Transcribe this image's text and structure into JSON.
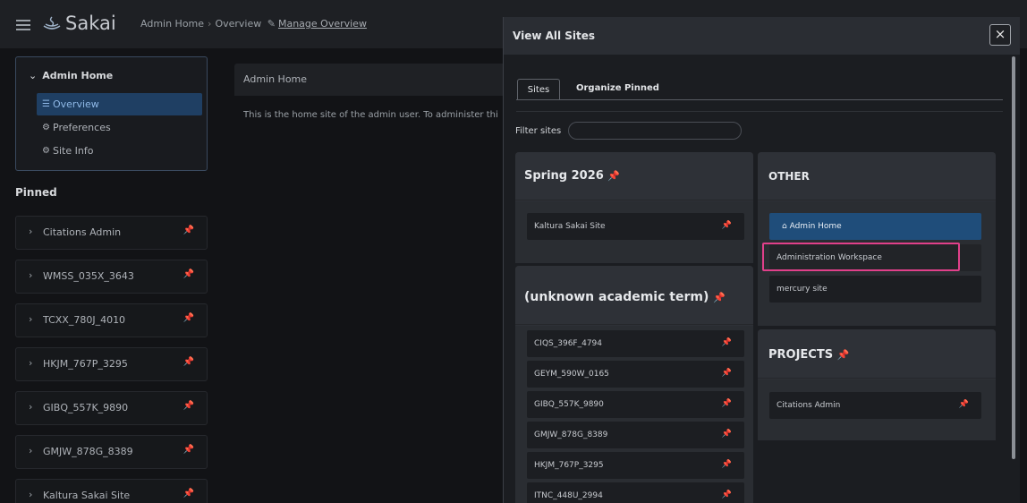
{
  "header": {
    "logo_text": "Sakai",
    "crumb_site": "Admin Home",
    "crumb_page": "Overview",
    "crumb_action": "Manage Overview"
  },
  "sitenav": {
    "title": "Admin Home",
    "items": [
      {
        "label": "Overview",
        "icon": "list-icon"
      },
      {
        "label": "Preferences",
        "icon": "gear-icon"
      },
      {
        "label": "Site Info",
        "icon": "gear-icon"
      }
    ]
  },
  "pinned": {
    "title": "Pinned",
    "items": [
      "Citations Admin",
      "WMSS_035X_3643",
      "TCXX_780J_4010",
      "HKJM_767P_3295",
      "GIBQ_557K_9890",
      "GMJW_878G_8389",
      "Kaltura Sakai Site"
    ]
  },
  "main": {
    "heading": "Admin Home",
    "text": "This is the home site of the admin user. To administer thi"
  },
  "modal": {
    "title": "View All Sites",
    "close": "×",
    "tabs": {
      "sites": "Sites",
      "pinned": "Organize Pinned"
    },
    "filter_label": "Filter sites",
    "spring": {
      "title": "Spring 2026",
      "sites": [
        "Kaltura Sakai Site"
      ]
    },
    "unknown": {
      "title": "(unknown academic term)",
      "sites": [
        "CIQS_396F_4794",
        "GEYM_590W_0165",
        "GIBQ_557K_9890",
        "GMJW_878G_8389",
        "HKJM_767P_3295",
        "ITNC_448U_2994"
      ]
    },
    "other": {
      "title": "OTHER",
      "sites": [
        "Admin Home",
        "Administration Workspace",
        "mercury site"
      ]
    },
    "projects": {
      "title": "PROJECTS",
      "sites": [
        "Citations Admin"
      ]
    }
  }
}
